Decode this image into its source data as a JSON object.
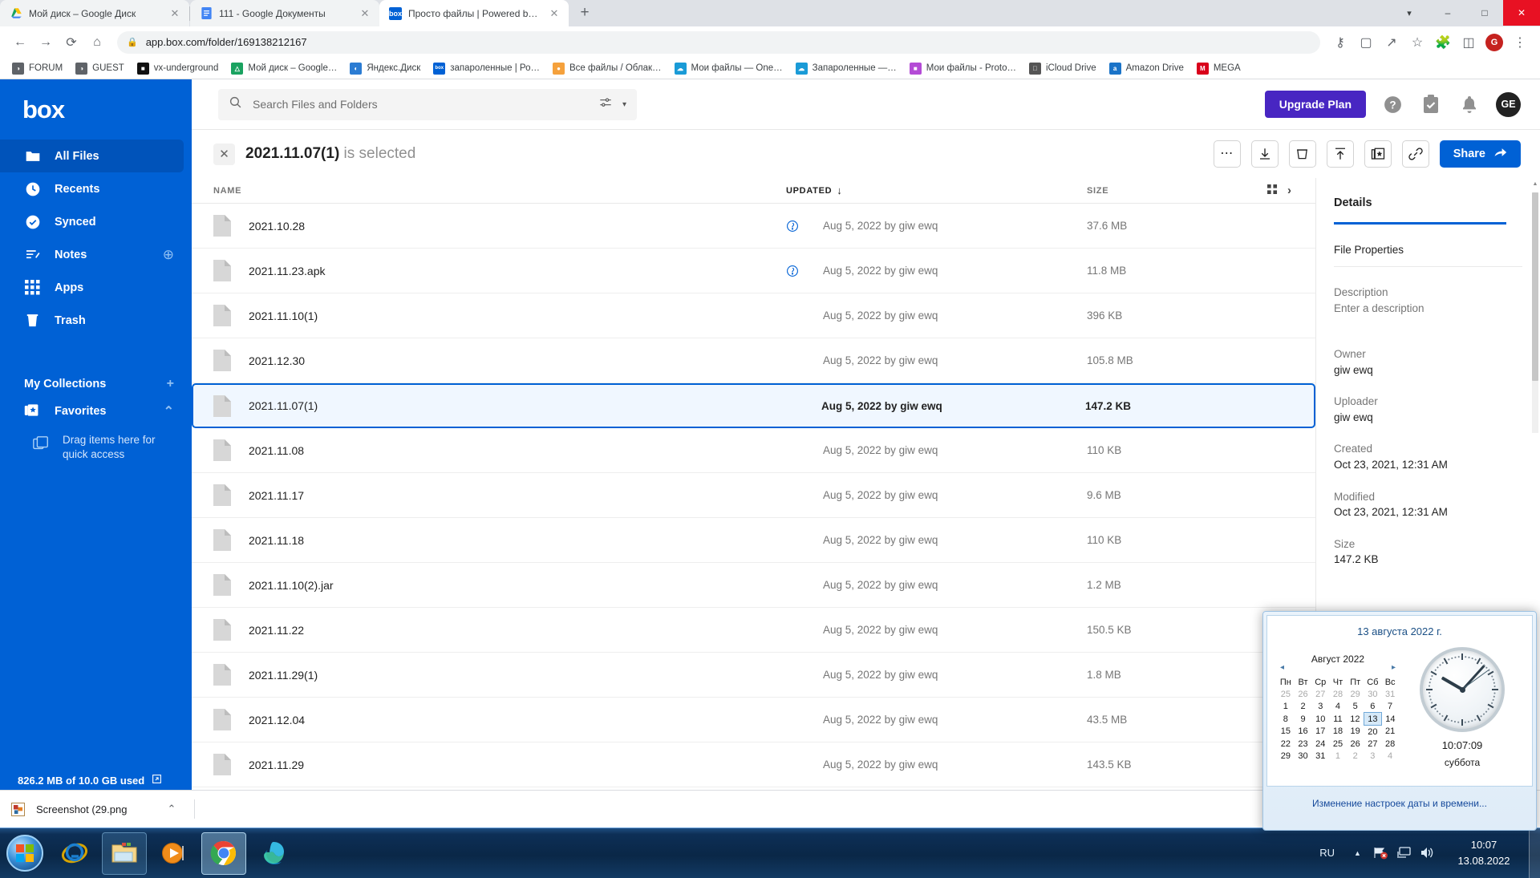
{
  "browser": {
    "tabs": [
      {
        "title": "Мой диск – Google Диск",
        "icon": "google-drive-icon",
        "active": false
      },
      {
        "title": "111 - Google Документы",
        "icon": "google-docs-icon",
        "active": false
      },
      {
        "title": "Просто файлы | Powered by Box",
        "icon": "box-icon",
        "active": true
      }
    ],
    "new_tab_label": "+",
    "window_controls": {
      "minimize": "–",
      "maximize": "□",
      "close": "✕"
    },
    "nav": {
      "back": "←",
      "forward": "→",
      "reload": "⟳",
      "home": "⌂"
    },
    "url": "app.box.com/folder/169138212167",
    "lock_icon": "lock-icon",
    "toolbar_icons": [
      "key-icon",
      "translate-icon",
      "share-icon",
      "star-icon",
      "extensions-icon",
      "sidepanel-icon"
    ],
    "profile_initial": "G",
    "menu_icon": "three-dots-vertical-icon",
    "bookmarks": [
      {
        "label": "FORUM",
        "color": "#5f6368",
        "glyph": "◑"
      },
      {
        "label": "GUEST",
        "color": "#5f6368",
        "glyph": "◑"
      },
      {
        "label": "vx-underground",
        "color": "#111111",
        "glyph": "■"
      },
      {
        "label": "Мой диск – Google…",
        "color": "#1aa260",
        "glyph": "△"
      },
      {
        "label": "Яндекс.Диск",
        "color": "#2b7cd3",
        "glyph": "◐"
      },
      {
        "label": "запароленные | Ро…",
        "color": "#0061d5",
        "glyph": "box"
      },
      {
        "label": "Все файлы / Облак…",
        "color": "#f5a13c",
        "glyph": "●"
      },
      {
        "label": "Мои файлы — One…",
        "color": "#1a9bd7",
        "glyph": "☁"
      },
      {
        "label": "Запароленные —…",
        "color": "#1a9bd7",
        "glyph": "☁"
      },
      {
        "label": "Мои файлы - Proto…",
        "color": "#b44bd6",
        "glyph": "■"
      },
      {
        "label": "iCloud Drive",
        "color": "#555555",
        "glyph": ""
      },
      {
        "label": "Amazon Drive",
        "color": "#1a73c8",
        "glyph": "a"
      },
      {
        "label": "MEGA",
        "color": "#d9001b",
        "glyph": "M"
      }
    ]
  },
  "sidebar": {
    "logo": "box",
    "items": [
      {
        "label": "All Files",
        "icon": "folder-icon",
        "active": true,
        "plus": false
      },
      {
        "label": "Recents",
        "icon": "clock-icon",
        "active": false,
        "plus": false
      },
      {
        "label": "Synced",
        "icon": "check-circle-icon",
        "active": false,
        "plus": false
      },
      {
        "label": "Notes",
        "icon": "notes-icon",
        "active": false,
        "plus": true
      },
      {
        "label": "Apps",
        "icon": "grid-icon",
        "active": false,
        "plus": false
      },
      {
        "label": "Trash",
        "icon": "trash-icon",
        "active": false,
        "plus": false
      }
    ],
    "collections_title": "My Collections",
    "collections_add": "+",
    "favorites_label": "Favorites",
    "favorites_collapse": "⌃",
    "drag_hint": "Drag items here for quick access",
    "storage_text": "826.2 MB of 10.0 GB used",
    "storage_icon": "external-link-icon"
  },
  "header": {
    "search_placeholder": "Search Files and Folders",
    "search_icon": "search-icon",
    "filter_icon": "filter-icon",
    "filter_caret": "▾",
    "upgrade_label": "Upgrade Plan",
    "icons": [
      "help-icon",
      "tasks-icon",
      "bell-icon"
    ],
    "avatar_initials": "GE"
  },
  "selection_bar": {
    "close_icon": "close-icon",
    "selected_name": "2021.11.07(1)",
    "selected_suffix": " is selected",
    "actions": [
      {
        "name": "more-options-button",
        "glyph": "•••"
      },
      {
        "name": "download-button",
        "glyph": "download"
      },
      {
        "name": "delete-button",
        "glyph": "trash"
      },
      {
        "name": "move-copy-button",
        "glyph": "upload"
      },
      {
        "name": "add-to-collection-button",
        "glyph": "collection"
      },
      {
        "name": "copy-link-button",
        "glyph": "link"
      }
    ],
    "share_label": "Share",
    "share_icon": "share-arrow-icon"
  },
  "table": {
    "columns": {
      "name": "NAME",
      "updated": "UPDATED",
      "size": "SIZE"
    },
    "sort_icon": "↓",
    "view_grid_icon": "grid-view-icon",
    "expand_icon": "›",
    "rows": [
      {
        "name": "2021.10.28",
        "updated": "Aug 5, 2022 by giw ewq",
        "size": "37.6 MB",
        "collab": true,
        "selected": false
      },
      {
        "name": "2021.11.23.apk",
        "updated": "Aug 5, 2022 by giw ewq",
        "size": "11.8 MB",
        "collab": true,
        "selected": false
      },
      {
        "name": "2021.11.10(1)",
        "updated": "Aug 5, 2022 by giw ewq",
        "size": "396 KB",
        "collab": false,
        "selected": false
      },
      {
        "name": "2021.12.30",
        "updated": "Aug 5, 2022 by giw ewq",
        "size": "105.8 MB",
        "collab": false,
        "selected": false
      },
      {
        "name": "2021.11.07(1)",
        "updated": "Aug 5, 2022 by giw ewq",
        "size": "147.2 KB",
        "collab": false,
        "selected": true
      },
      {
        "name": "2021.11.08",
        "updated": "Aug 5, 2022 by giw ewq",
        "size": "110 KB",
        "collab": false,
        "selected": false
      },
      {
        "name": "2021.11.17",
        "updated": "Aug 5, 2022 by giw ewq",
        "size": "9.6 MB",
        "collab": false,
        "selected": false
      },
      {
        "name": "2021.11.18",
        "updated": "Aug 5, 2022 by giw ewq",
        "size": "110 KB",
        "collab": false,
        "selected": false
      },
      {
        "name": "2021.11.10(2).jar",
        "updated": "Aug 5, 2022 by giw ewq",
        "size": "1.2 MB",
        "collab": false,
        "selected": false
      },
      {
        "name": "2021.11.22",
        "updated": "Aug 5, 2022 by giw ewq",
        "size": "150.5 KB",
        "collab": false,
        "selected": false
      },
      {
        "name": "2021.11.29(1)",
        "updated": "Aug 5, 2022 by giw ewq",
        "size": "1.8 MB",
        "collab": false,
        "selected": false
      },
      {
        "name": "2021.12.04",
        "updated": "Aug 5, 2022 by giw ewq",
        "size": "43.5 MB",
        "collab": false,
        "selected": false
      },
      {
        "name": "2021.11.29",
        "updated": "Aug 5, 2022 by giw ewq",
        "size": "143.5 KB",
        "collab": false,
        "selected": false
      }
    ]
  },
  "details": {
    "tab_label": "Details",
    "section_title": "File Properties",
    "fields": [
      {
        "label": "Description",
        "value": "Enter a description"
      },
      {
        "label": "Owner",
        "value": "giw ewq"
      },
      {
        "label": "Uploader",
        "value": "giw ewq"
      },
      {
        "label": "Created",
        "value": "Oct 23, 2021, 12:31 AM"
      },
      {
        "label": "Modified",
        "value": "Oct 23, 2021, 12:31 AM"
      },
      {
        "label": "Size",
        "value": "147.2 KB"
      }
    ]
  },
  "downloads": {
    "file_name": "Screenshot (29.png",
    "caret": "⌃",
    "thumb_icon": "image-file-icon"
  },
  "taskbar": {
    "start_icon": "windows-start-icon",
    "buttons": [
      {
        "name": "taskbar-internet-explorer",
        "state": "idle"
      },
      {
        "name": "taskbar-file-explorer",
        "state": "open"
      },
      {
        "name": "taskbar-media-player",
        "state": "idle"
      },
      {
        "name": "taskbar-google-chrome",
        "state": "pressed"
      },
      {
        "name": "taskbar-microsoft-edge",
        "state": "idle"
      }
    ],
    "tray": {
      "language": "RU",
      "show_hidden_icon": "chevron-up-icon",
      "network_icon": "network-error-icon",
      "display_icon": "display-icon",
      "volume_icon": "volume-icon",
      "time": "10:07",
      "date": "13.08.2022"
    }
  },
  "clock_flyout": {
    "full_date": "13 августа 2022 г.",
    "month_title": "Август 2022",
    "prev_arrow": "◂",
    "next_arrow": "▸",
    "weekdays": [
      "Пн",
      "Вт",
      "Ср",
      "Чт",
      "Пт",
      "Сб",
      "Вс"
    ],
    "weeks": [
      [
        {
          "d": "25",
          "m": true
        },
        {
          "d": "26",
          "m": true
        },
        {
          "d": "27",
          "m": true
        },
        {
          "d": "28",
          "m": true
        },
        {
          "d": "29",
          "m": true
        },
        {
          "d": "30",
          "m": true
        },
        {
          "d": "31",
          "m": true
        }
      ],
      [
        {
          "d": "1"
        },
        {
          "d": "2"
        },
        {
          "d": "3"
        },
        {
          "d": "4"
        },
        {
          "d": "5"
        },
        {
          "d": "6"
        },
        {
          "d": "7"
        }
      ],
      [
        {
          "d": "8"
        },
        {
          "d": "9"
        },
        {
          "d": "10"
        },
        {
          "d": "11"
        },
        {
          "d": "12"
        },
        {
          "d": "13",
          "t": true
        },
        {
          "d": "14"
        }
      ],
      [
        {
          "d": "15"
        },
        {
          "d": "16"
        },
        {
          "d": "17"
        },
        {
          "d": "18"
        },
        {
          "d": "19"
        },
        {
          "d": "20"
        },
        {
          "d": "21"
        }
      ],
      [
        {
          "d": "22"
        },
        {
          "d": "23"
        },
        {
          "d": "24"
        },
        {
          "d": "25"
        },
        {
          "d": "26"
        },
        {
          "d": "27"
        },
        {
          "d": "28"
        }
      ],
      [
        {
          "d": "29"
        },
        {
          "d": "30"
        },
        {
          "d": "31"
        },
        {
          "d": "1",
          "m": true
        },
        {
          "d": "2",
          "m": true
        },
        {
          "d": "3",
          "m": true
        },
        {
          "d": "4",
          "m": true
        }
      ]
    ],
    "time": "10:07:09",
    "weekday": "суббота",
    "settings_link": "Изменение настроек даты и времени..."
  },
  "colors": {
    "box_blue": "#0061d5",
    "box_blue_dark": "#0053ba",
    "upgrade_purple": "#4826c2",
    "chrome_tabbar": "#dee1e6"
  }
}
